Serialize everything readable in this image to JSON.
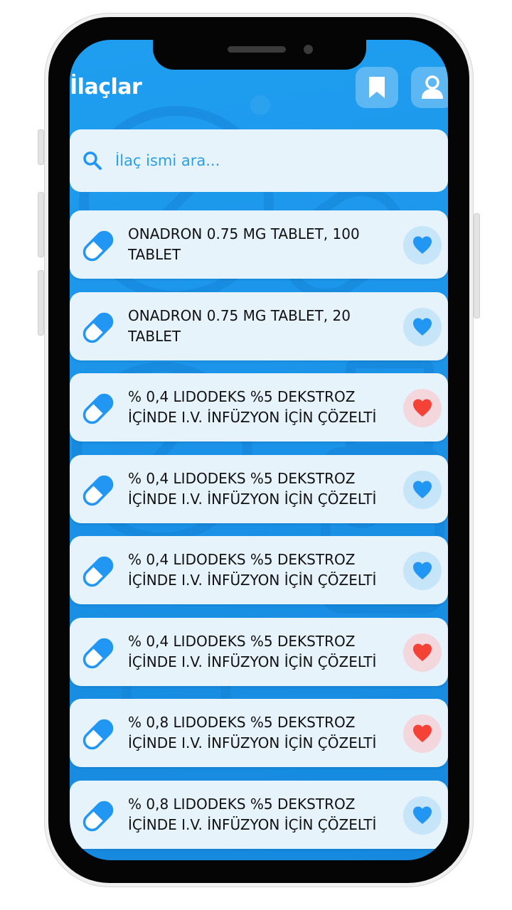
{
  "header": {
    "title": "İlaçlar"
  },
  "search": {
    "placeholder": "İlaç ismi ara..."
  },
  "icons": {
    "bookmark": "bookmark-icon",
    "profile": "user-icon",
    "search": "search-icon",
    "item": "pill-icon",
    "favorite": "heart-icon"
  },
  "colors": {
    "background": "#1b93e8",
    "card": "#e6f3fb",
    "accent": "#2196f3",
    "favorite_active": "#f44336"
  },
  "medicines": [
    {
      "name": "ONADRON 0.75 MG TABLET, 100 TABLET",
      "favorite": false
    },
    {
      "name": "ONADRON 0.75 MG TABLET, 20 TABLET",
      "favorite": false
    },
    {
      "name": "% 0,4 LIDODEKS %5 DEKSTROZ İÇİNDE I.V. İNFÜZYON İÇİN ÇÖZELTİ",
      "favorite": true
    },
    {
      "name": "% 0,4 LIDODEKS %5 DEKSTROZ İÇİNDE I.V. İNFÜZYON İÇİN ÇÖZELTİ",
      "favorite": false
    },
    {
      "name": "% 0,4 LIDODEKS %5 DEKSTROZ İÇİNDE I.V. İNFÜZYON İÇİN ÇÖZELTİ",
      "favorite": false
    },
    {
      "name": "% 0,4 LIDODEKS %5 DEKSTROZ İÇİNDE I.V. İNFÜZYON İÇİN ÇÖZELTİ",
      "favorite": true
    },
    {
      "name": "% 0,8 LIDODEKS %5 DEKSTROZ İÇİNDE I.V. İNFÜZYON İÇİN ÇÖZELTİ",
      "favorite": true
    },
    {
      "name": "% 0,8 LIDODEKS %5 DEKSTROZ İÇİNDE I.V. İNFÜZYON İÇİN ÇÖZELTİ",
      "favorite": false
    }
  ]
}
